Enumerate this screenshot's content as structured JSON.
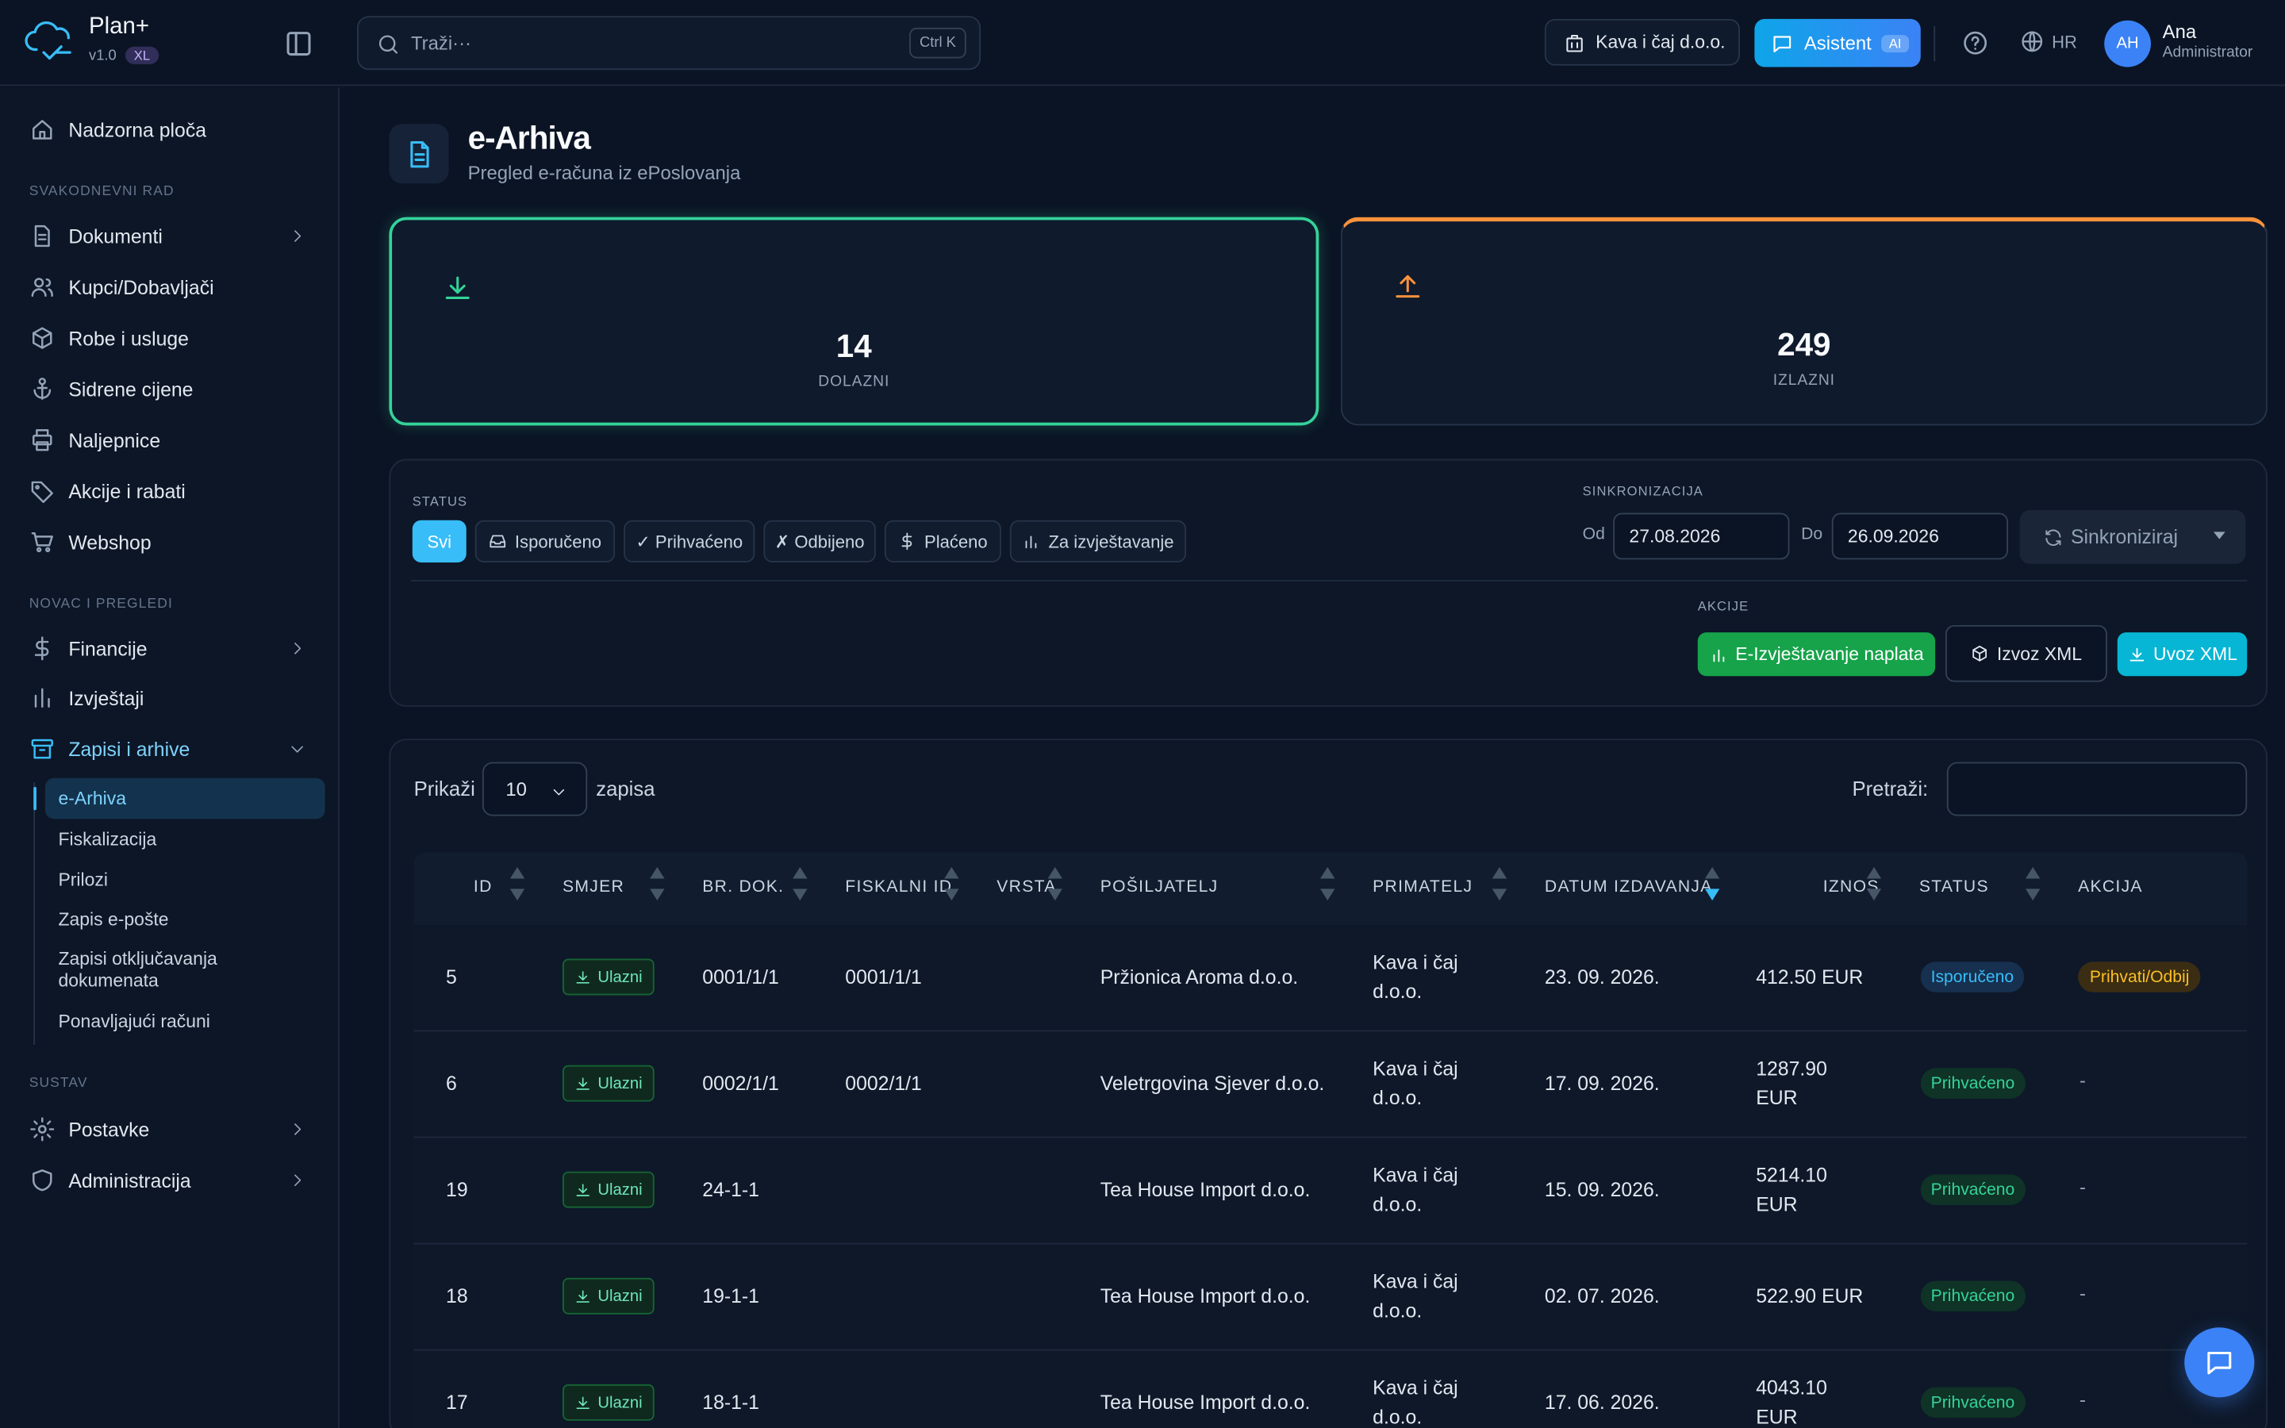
{
  "app": {
    "name": "Plan+",
    "version": "v1.0",
    "edition": "XL"
  },
  "header": {
    "search_placeholder": "Traži···",
    "search_shortcut": "Ctrl K",
    "company": "Kava i čaj d.o.o.",
    "assistant_label": "Asistent",
    "assistant_badge": "AI",
    "language": "HR",
    "user": {
      "initials": "AH",
      "name": "Ana",
      "role": "Administrator"
    }
  },
  "sidebar": {
    "dashboard": "Nadzorna ploča",
    "section_daily": "SVAKODNEVNI RAD",
    "documents": "Dokumenti",
    "customers": "Kupci/Dobavljači",
    "goods": "Robe i usluge",
    "anchor_prices": "Sidrene cijene",
    "labels": "Naljepnice",
    "promotions": "Akcije i rabati",
    "webshop": "Webshop",
    "section_money": "NOVAC I PREGLEDI",
    "finance": "Financije",
    "reports": "Izvještaji",
    "records": "Zapisi i arhive",
    "records_sub": {
      "earchive": "e-Arhiva",
      "fiscal": "Fiskalizacija",
      "attachments": "Prilozi",
      "email_log": "Zapis e-pošte",
      "unlock_log": "Zapisi otključavanja dokumenata",
      "recurring": "Ponavljajući računi"
    },
    "section_system": "SUSTAV",
    "settings": "Postavke",
    "admin": "Administracija"
  },
  "page": {
    "title": "e-Arhiva",
    "subtitle": "Pregled e-računa iz ePoslovanja"
  },
  "stats": {
    "incoming": {
      "value": "14",
      "label": "DOLAZNI",
      "color": "#34d399"
    },
    "outgoing": {
      "value": "249",
      "label": "IZLAZNI",
      "color": "#fb923c"
    }
  },
  "filters": {
    "status_label": "STATUS",
    "chips": [
      "Svi",
      "Isporučeno",
      "✓ Prihvaćeno",
      "✗ Odbijeno",
      "Plaćeno",
      "Za izvještavanje"
    ],
    "active_chip": "Svi",
    "sync_label": "SINKRONIZACIJA",
    "from_label": "Od",
    "from_date": "27.08.2026",
    "to_label": "Do",
    "to_date": "26.09.2026",
    "sync_button": "Sinkroniziraj",
    "actions_label": "AKCIJE",
    "btn_ereport": "E-Izvještavanje naplata",
    "btn_export": "Izvoz XML",
    "btn_import": "Uvoz XML"
  },
  "table": {
    "show_label": "Prikaži",
    "page_size": "10",
    "records_label": "zapisa",
    "search_label": "Pretraži:",
    "columns": [
      "ID",
      "SMJER",
      "BR. DOK.",
      "FISKALNI ID",
      "VRSTA",
      "POŠILJATELJ",
      "PRIMATELJ",
      "DATUM IZDAVANJA",
      "IZNOS",
      "STATUS",
      "AKCIJA"
    ],
    "rows": [
      {
        "id": "5",
        "direction": "Ulazni",
        "doc": "0001/1/1",
        "fiscal": "0001/1/1",
        "type": "",
        "sender": "Pržionica Aroma d.o.o.",
        "receiver": "Kava i čaj d.o.o.",
        "date": "23. 09. 2026.",
        "amount": "412.50 EUR",
        "status": "Isporučeno",
        "action": "Prihvati/Odbij"
      },
      {
        "id": "6",
        "direction": "Ulazni",
        "doc": "0002/1/1",
        "fiscal": "0002/1/1",
        "type": "",
        "sender": "Veletrgovina Sjever d.o.o.",
        "receiver": "Kava i čaj d.o.o.",
        "date": "17. 09. 2026.",
        "amount": "1287.90 EUR",
        "status": "Prihvaćeno",
        "action": "-"
      },
      {
        "id": "19",
        "direction": "Ulazni",
        "doc": "24-1-1",
        "fiscal": "",
        "type": "",
        "sender": "Tea House Import d.o.o.",
        "receiver": "Kava i čaj d.o.o.",
        "date": "15. 09. 2026.",
        "amount": "5214.10 EUR",
        "status": "Prihvaćeno",
        "action": "-"
      },
      {
        "id": "18",
        "direction": "Ulazni",
        "doc": "19-1-1",
        "fiscal": "",
        "type": "",
        "sender": "Tea House Import d.o.o.",
        "receiver": "Kava i čaj d.o.o.",
        "date": "02. 07. 2026.",
        "amount": "522.90 EUR",
        "status": "Prihvaćeno",
        "action": "-"
      },
      {
        "id": "17",
        "direction": "Ulazni",
        "doc": "18-1-1",
        "fiscal": "",
        "type": "",
        "sender": "Tea House Import d.o.o.",
        "receiver": "Kava i čaj d.o.o.",
        "date": "17. 06. 2026.",
        "amount": "4043.10 EUR",
        "status": "Prihvaćeno",
        "action": "-"
      }
    ]
  },
  "colors": {
    "accent": "#38bdf8",
    "background": "#0b1424",
    "success": "#16a34a",
    "warning": "#fbbf24"
  }
}
